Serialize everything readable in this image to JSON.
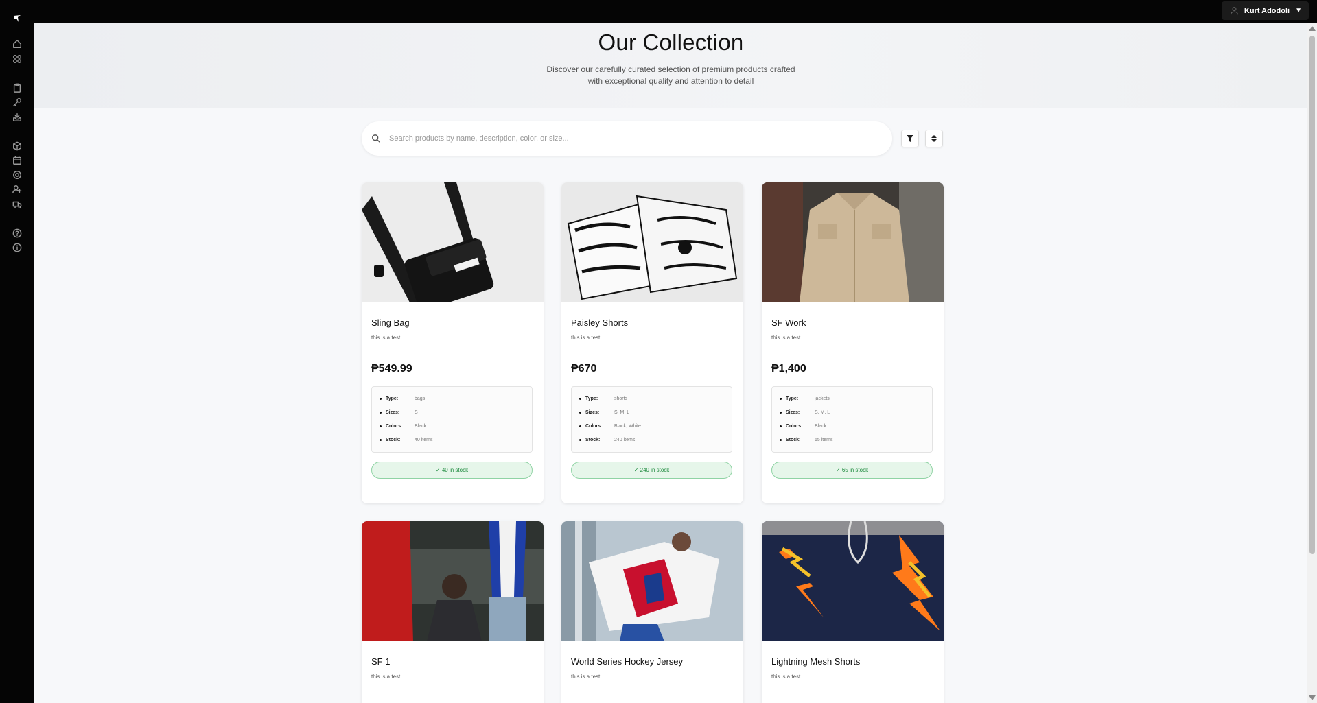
{
  "header": {
    "user_name": "Kurt Adodoli",
    "caret": "▼"
  },
  "sidebar": {
    "icons": [
      "home-icon",
      "grid-icon",
      "clipboard-icon",
      "key-icon",
      "inbox-icon",
      "box-icon",
      "calendar-icon",
      "settings-icon",
      "user-plus-icon",
      "truck-icon",
      "help-icon",
      "info-icon"
    ]
  },
  "hero": {
    "title": "Our Collection",
    "subtitle": "Discover our carefully curated selection of premium products crafted with exceptional quality and attention to detail"
  },
  "search": {
    "placeholder": "Search products by name, description, color, or size..."
  },
  "labels": {
    "type": "Type:",
    "sizes": "Sizes:",
    "colors": "Colors:",
    "stock": "Stock:"
  },
  "products": [
    {
      "name": "Sling Bag",
      "desc": "this is a test",
      "price": "₱549.99",
      "type": "bags",
      "sizes": "S",
      "colors": "Black",
      "stock": "40 items",
      "badge": "✓ 40 in stock"
    },
    {
      "name": "Paisley Shorts",
      "desc": "this is a test",
      "price": "₱670",
      "type": "shorts",
      "sizes": "S, M, L",
      "colors": "Black, White",
      "stock": "240 items",
      "badge": "✓ 240 in stock"
    },
    {
      "name": "SF Work",
      "desc": "this is a test",
      "price": "₱1,400",
      "type": "jackets",
      "sizes": "S, M, L",
      "colors": "Black",
      "stock": "65 items",
      "badge": "✓ 65 in stock"
    },
    {
      "name": "SF 1",
      "desc": "this is a test"
    },
    {
      "name": "World Series Hockey Jersey",
      "desc": "this is a test"
    },
    {
      "name": "Lightning Mesh Shorts",
      "desc": "this is a test"
    }
  ],
  "colors": {
    "accent_green": "#1e8a3e",
    "sidebar_bg": "#050505"
  }
}
